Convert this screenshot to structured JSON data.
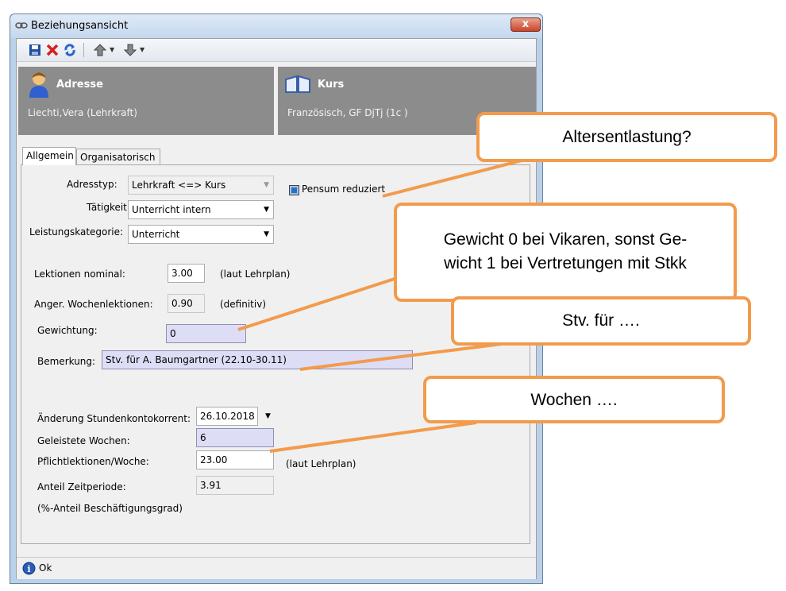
{
  "window": {
    "title": "Beziehungsansicht",
    "close_label": "x"
  },
  "toolbar": {
    "icons": [
      "save-icon",
      "delete-icon",
      "refresh-icon",
      "arrow-up-icon",
      "arrow-down-icon"
    ]
  },
  "panels": {
    "left": {
      "title": "Adresse",
      "subtitle": "Liechti,Vera (Lehrkraft)"
    },
    "right": {
      "title": "Kurs",
      "subtitle": "Französisch, GF DjTj (1c )"
    }
  },
  "tabs": [
    {
      "label": "Allgemein",
      "active": true
    },
    {
      "label": "Organisatorisch",
      "active": false
    }
  ],
  "form": {
    "adresstyp_label": "Adresstyp:",
    "adresstyp_value": "Lehrkraft <=> Kurs",
    "taetigkeit_label": "Tätigkeit:",
    "taetigkeit_value": "Unterricht intern",
    "leistung_label": "Leistungskategorie:",
    "leistung_value": "Unterricht",
    "pensum_label": "Pensum reduziert",
    "lektionen_label": "Lektionen nominal:",
    "lektionen_value": "3.00",
    "lektionen_note": "(laut Lehrplan)",
    "anger_label": "Anger. Wochenlektionen:",
    "anger_value": "0.90",
    "anger_note": "(definitiv)",
    "gewichtung_label": "Gewichtung:",
    "gewichtung_value": "0",
    "bemerkung_label": "Bemerkung:",
    "bemerkung_value": "Stv. für A. Baumgartner (22.10-30.11)",
    "aenderung_label": "Änderung Stundenkontokorrent:",
    "aenderung_value": "26.10.2018",
    "wochen_label": "Geleistete Wochen:",
    "wochen_value": "6",
    "pflicht_label": "Pflichtlektionen/Woche:",
    "pflicht_value": "23.00",
    "pflicht_note": "(laut Lehrplan)",
    "anteil_label": "Anteil Zeitperiode:",
    "anteil_value": "3.91",
    "anteil_note": "(%-Anteil Beschäftigungsgrad)"
  },
  "status": {
    "text": "Ok"
  },
  "callouts": {
    "c1": "Altersentlastung?",
    "c2_line1": "Gewicht 0 bei Vikaren, sonst Ge-",
    "c2_line2": "wicht 1 bei Vertretungen mit Stkk",
    "c3": "Stv. für ….",
    "c4": "Wochen …."
  },
  "colors": {
    "callout_border": "#f29b4d",
    "panel_bg": "#8c8c8c",
    "highlight_field": "#ddddf6"
  }
}
